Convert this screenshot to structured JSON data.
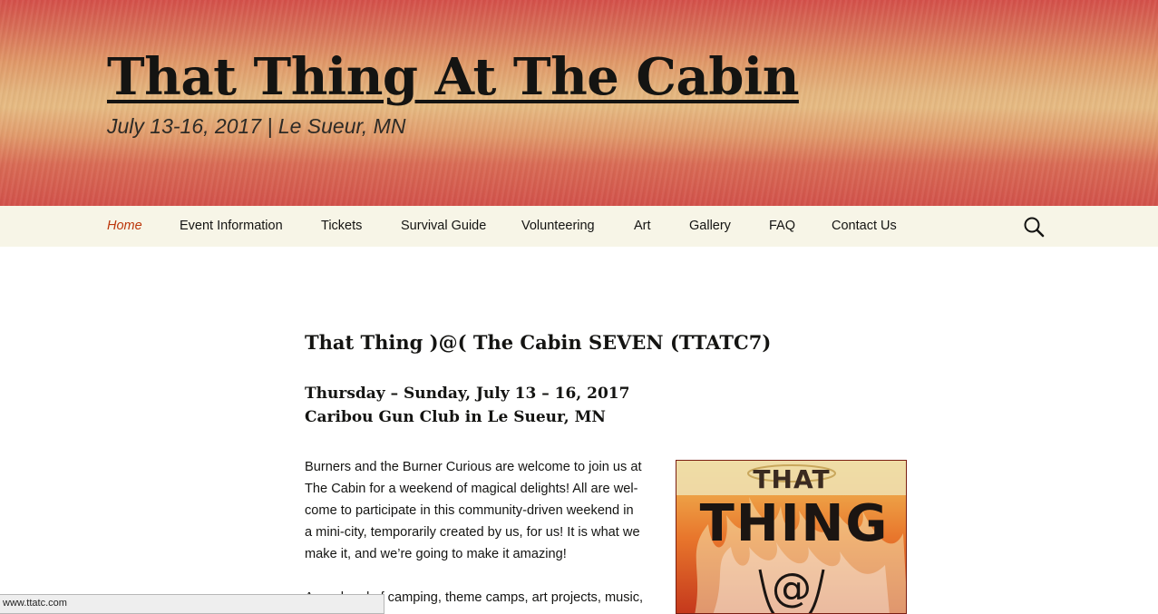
{
  "header": {
    "site_title": "That Thing At The Cabin",
    "tagline": "July 13-16, 2017 | Le Sueur, MN"
  },
  "nav": {
    "items": [
      {
        "label": "Home",
        "active": true
      },
      {
        "label": "Event Information"
      },
      {
        "label": "Tickets"
      },
      {
        "label": "Survival Guide"
      },
      {
        "label": "Volunteering"
      },
      {
        "label": "Art"
      },
      {
        "label": "Gallery"
      },
      {
        "label": "FAQ"
      },
      {
        "label": "Contact Us"
      }
    ],
    "search_icon": "search-icon"
  },
  "post": {
    "title": "That Thing )@( The Cabin SEVEN (TTATC7)",
    "dates": "Thursday – Sunday, July 13 – 16, 2017",
    "venue": "Caribou Gun Club in Le Sueur, MN",
    "paragraph1_lines": [
      "Burners and the Burner Curious are welcome to join us at",
      "The Cabin for a weekend of magical delights! All are wel-",
      "come to participate in this community-driven weekend in",
      "a mini-city, temporarily created by us, for us! It is what we",
      "make it, and we’re going to make it amazing!"
    ],
    "paragraph2_visible": "A weekend of camping, theme camps, art projects, music,"
  },
  "poster": {
    "line1": "THAT",
    "line2": "THING",
    "symbol": "@"
  },
  "status_bar": {
    "url": "www.ttatc.com"
  },
  "colors": {
    "accent": "#bc360a",
    "nav_bg": "#f7f5e7",
    "header_red": "#d4504a",
    "header_gold": "#e6ba82"
  }
}
